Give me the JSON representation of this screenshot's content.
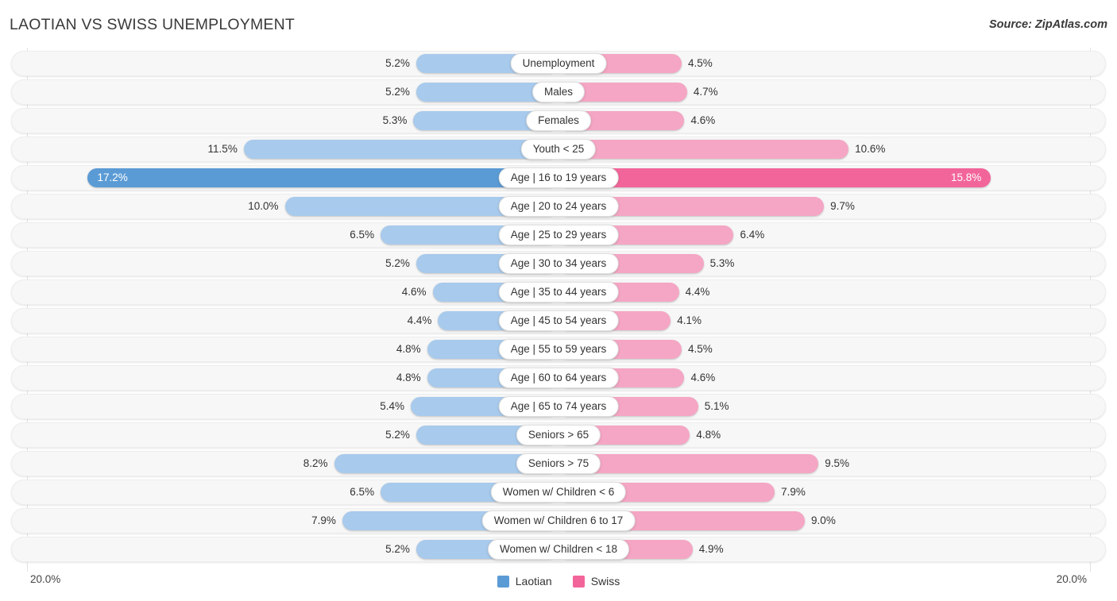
{
  "header": {
    "title": "LAOTIAN VS SWISS UNEMPLOYMENT",
    "source": "Source: ZipAtlas.com"
  },
  "axis": {
    "left_label": "20.0%",
    "right_label": "20.0%"
  },
  "legend": {
    "items": [
      {
        "label": "Laotian",
        "color": "#5B9BD5"
      },
      {
        "label": "Swiss",
        "color": "#F2659A"
      }
    ]
  },
  "colors": {
    "laotian_light": "#A8CAEC",
    "laotian_dark": "#5B9BD5",
    "swiss_light": "#F5A6C4",
    "swiss_dark": "#F2659A",
    "track": "#F7F7F7",
    "gridline": "#E3E3E3"
  },
  "chart_data": {
    "type": "bar",
    "orientation": "horizontal-diverging",
    "title": "LAOTIAN VS SWISS UNEMPLOYMENT",
    "xlabel": "",
    "ylabel": "",
    "xlim": [
      20.0,
      20.0
    ],
    "axis_max": 20.0,
    "grid": true,
    "legend_position": "bottom-center",
    "categories": [
      "Unemployment",
      "Males",
      "Females",
      "Youth < 25",
      "Age | 16 to 19 years",
      "Age | 20 to 24 years",
      "Age | 25 to 29 years",
      "Age | 30 to 34 years",
      "Age | 35 to 44 years",
      "Age | 45 to 54 years",
      "Age | 55 to 59 years",
      "Age | 60 to 64 years",
      "Age | 65 to 74 years",
      "Seniors > 65",
      "Seniors > 75",
      "Women w/ Children < 6",
      "Women w/ Children 6 to 17",
      "Women w/ Children < 18"
    ],
    "series": [
      {
        "name": "Laotian",
        "side": "left",
        "color": "#A8CAEC",
        "values": [
          5.2,
          5.2,
          5.3,
          11.5,
          17.2,
          10.0,
          6.5,
          5.2,
          4.6,
          4.4,
          4.8,
          4.8,
          5.4,
          5.2,
          8.2,
          6.5,
          7.9,
          5.2
        ],
        "labels": [
          "5.2%",
          "5.2%",
          "5.3%",
          "11.5%",
          "17.2%",
          "10.0%",
          "6.5%",
          "5.2%",
          "4.6%",
          "4.4%",
          "4.8%",
          "4.8%",
          "5.4%",
          "5.2%",
          "8.2%",
          "6.5%",
          "7.9%",
          "5.2%"
        ]
      },
      {
        "name": "Swiss",
        "side": "right",
        "color": "#F5A6C4",
        "values": [
          4.5,
          4.7,
          4.6,
          10.6,
          15.8,
          9.7,
          6.4,
          5.3,
          4.4,
          4.1,
          4.5,
          4.6,
          5.1,
          4.8,
          9.5,
          7.9,
          9.0,
          4.9
        ],
        "labels": [
          "4.5%",
          "4.7%",
          "4.6%",
          "10.6%",
          "15.8%",
          "9.7%",
          "6.4%",
          "5.3%",
          "4.4%",
          "4.1%",
          "4.5%",
          "4.6%",
          "5.1%",
          "4.8%",
          "9.5%",
          "7.9%",
          "9.0%",
          "4.9%"
        ]
      }
    ],
    "highlighted_row_index": 4
  }
}
